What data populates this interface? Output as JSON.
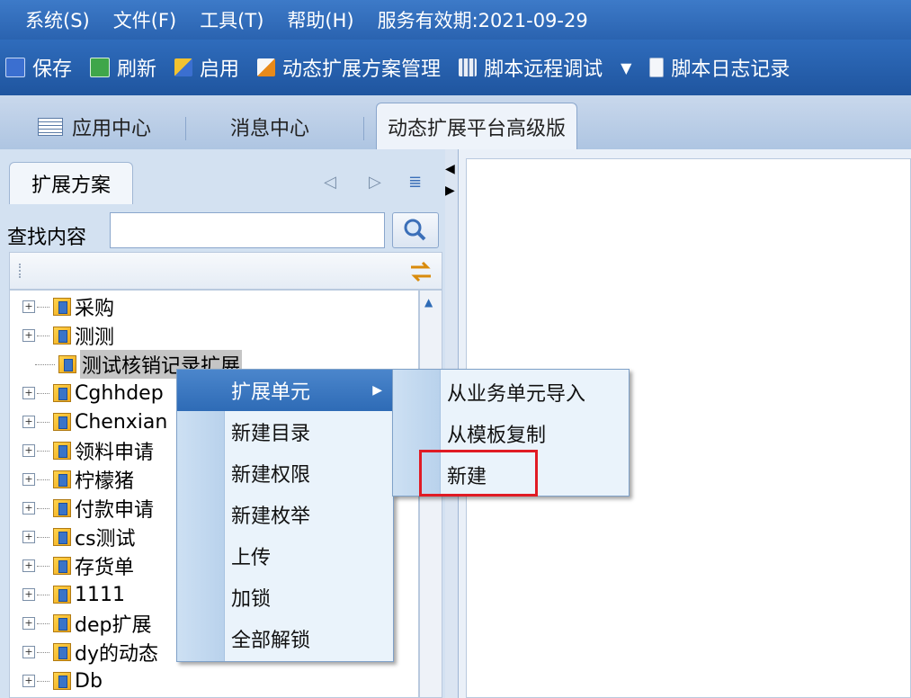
{
  "menubar": {
    "items": [
      "系统(S)",
      "文件(F)",
      "工具(T)",
      "帮助(H)"
    ],
    "service_valid": "服务有效期:2021-09-29"
  },
  "toolbar": {
    "save": "保存",
    "refresh": "刷新",
    "enable": "启用",
    "ext_plan_mgmt": "动态扩展方案管理",
    "script_remote_debug": "脚本远程调试",
    "script_log": "脚本日志记录"
  },
  "tabs": {
    "app_center": "应用中心",
    "msg_center": "消息中心",
    "dynamic_platform": "动态扩展平台高级版"
  },
  "left": {
    "subtab": "扩展方案",
    "search_label": "查找内容",
    "search_value": "",
    "tree": [
      {
        "label": "采购",
        "expandable": true
      },
      {
        "label": "测测",
        "expandable": true
      },
      {
        "label": "测试核销记录扩展",
        "expandable": false,
        "selected": true
      },
      {
        "label": "Cghhdep",
        "expandable": true
      },
      {
        "label": "Chenxian",
        "expandable": true
      },
      {
        "label": "领料申请",
        "expandable": true
      },
      {
        "label": "柠檬猪",
        "expandable": true
      },
      {
        "label": "付款申请",
        "expandable": true
      },
      {
        "label": "cs测试",
        "expandable": true
      },
      {
        "label": "存货单",
        "expandable": true
      },
      {
        "label": "1111",
        "expandable": true
      },
      {
        "label": "dep扩展",
        "expandable": true
      },
      {
        "label": "dy的动态",
        "expandable": true
      },
      {
        "label": "Db",
        "expandable": true
      }
    ]
  },
  "context_menu": {
    "items": [
      "扩展单元",
      "新建目录",
      "新建权限",
      "新建枚举",
      "上传",
      "加锁",
      "全部解锁"
    ],
    "highlighted": "扩展单元"
  },
  "submenu": {
    "items": [
      "从业务单元导入",
      "从模板复制",
      "新建"
    ],
    "marked": "新建"
  }
}
